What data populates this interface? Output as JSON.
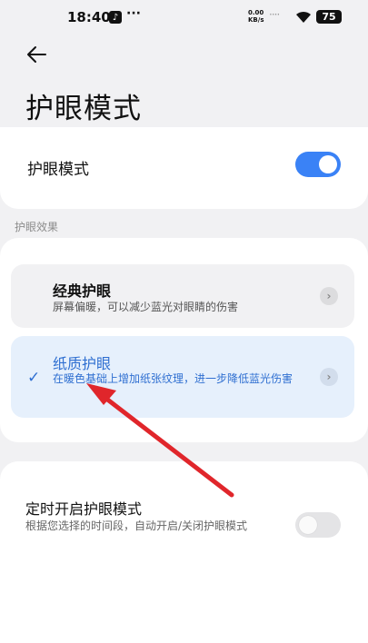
{
  "status_bar": {
    "time": "18:40",
    "more": "···",
    "net_speed_value": "0.00",
    "net_speed_unit": "KB/s",
    "signal": "····",
    "battery": "75"
  },
  "header": {
    "title": "护眼模式"
  },
  "eye_mode": {
    "label": "护眼模式",
    "enabled": true
  },
  "effects": {
    "section_label": "护眼效果",
    "options": [
      {
        "title": "经典护眼",
        "description": "屏幕偏暖，可以减少蓝光对眼睛的伤害",
        "selected": false
      },
      {
        "title": "纸质护眼",
        "description": "在暖色基础上增加纸张纹理，进一步降低蓝光伤害",
        "selected": true
      }
    ]
  },
  "schedule": {
    "title": "定时开启护眼模式",
    "description": "根据您选择的时间段，自动开启/关闭护眼模式",
    "enabled": false
  },
  "colors": {
    "accent": "#3a82f6",
    "selected_text": "#2f6fd1",
    "selected_bg": "#e6f0fc",
    "annotation_arrow": "#e0262b"
  }
}
